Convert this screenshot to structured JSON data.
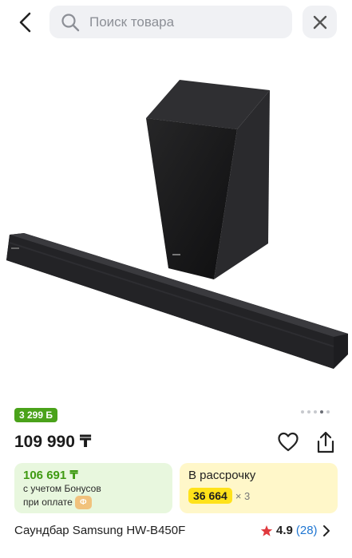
{
  "search": {
    "placeholder": "Поиск товара"
  },
  "icons": {
    "back": "chevron-left-icon",
    "search": "search-icon",
    "close": "close-icon",
    "favorite": "heart-icon",
    "share": "share-icon",
    "star": "star-icon",
    "chevron": "chevron-right-icon"
  },
  "gallery": {
    "slides_total": 5,
    "active_slide": 4
  },
  "bonus_badge": "3 299 Б",
  "price": "109 990 ₸",
  "bonus_card": {
    "price": "106 691 ₸",
    "line1": "с учетом Бонусов",
    "line2": "при оплате"
  },
  "credit_card": {
    "title": "В рассрочку",
    "amount": "36 664",
    "multiplier": "× 3"
  },
  "product": {
    "title": "Саундбар Samsung HW-B450F",
    "rating": "4.9",
    "reviews": "(28)"
  },
  "colors": {
    "green": "#4aa21a",
    "star": "#e0393e",
    "yellow": "#ffe21a",
    "link": "#1f76d2"
  }
}
